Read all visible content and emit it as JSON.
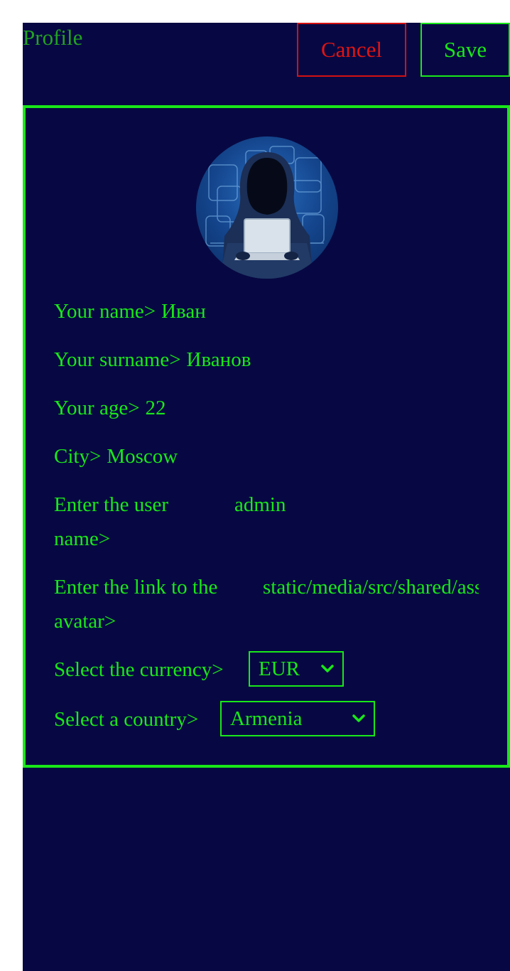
{
  "header": {
    "title": "Profile",
    "cancel_label": "Cancel",
    "save_label": "Save"
  },
  "profile": {
    "avatar_alt": "Hacker in hoodie avatar",
    "fields": [
      {
        "label": "Your name>",
        "value": "Иван"
      },
      {
        "label": "Your surname>",
        "value": "Иванов"
      },
      {
        "label": "Your age>",
        "value": "22"
      },
      {
        "label": "City>",
        "value": "Moscow"
      }
    ],
    "username": {
      "label_line1": "Enter the user",
      "label_line2": "name>",
      "value": "admin"
    },
    "avatar_link": {
      "label_line1": "Enter the link to the",
      "label_line2": "avatar>",
      "value": "static/media/src/shared/assets/avatar.jpg"
    },
    "currency": {
      "label": "Select the currency>",
      "selected": "EUR"
    },
    "country": {
      "label": "Select a country>",
      "selected": "Armenia"
    }
  },
  "colors": {
    "background": "#070843",
    "accent_green": "#19e819",
    "cancel_red": "#e01414",
    "title_green": "#22a322"
  }
}
